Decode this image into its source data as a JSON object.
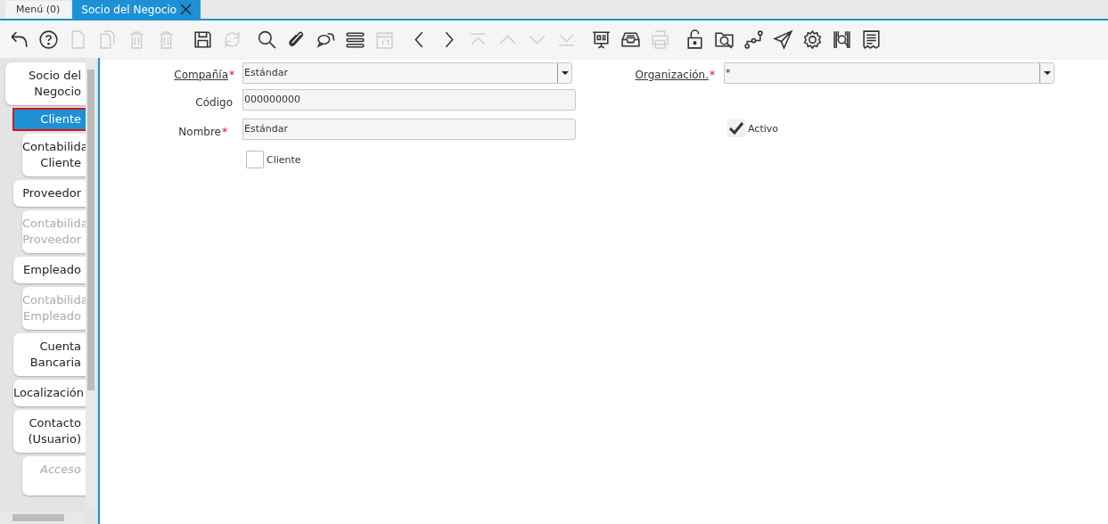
{
  "window_tabs": [
    {
      "label": "Menú (0)",
      "selected": false,
      "closable": false
    },
    {
      "label": "Socio del Negocio",
      "selected": true,
      "closable": true
    }
  ],
  "toolbar": [
    {
      "kind": "undo",
      "disabled": false
    },
    {
      "kind": "help",
      "disabled": false
    },
    {
      "kind": "new",
      "disabled": true
    },
    {
      "kind": "copy",
      "disabled": true
    },
    {
      "kind": "delete",
      "disabled": true
    },
    {
      "kind": "delete",
      "disabled": true
    },
    {
      "kind": "save",
      "disabled": false
    },
    {
      "kind": "refresh",
      "disabled": true
    },
    {
      "kind": "search",
      "disabled": false
    },
    {
      "kind": "attach",
      "disabled": false
    },
    {
      "kind": "chat",
      "disabled": false
    },
    {
      "kind": "menu",
      "disabled": false
    },
    {
      "kind": "calendar",
      "disabled": true
    },
    {
      "kind": "prev",
      "disabled": false
    },
    {
      "kind": "next",
      "disabled": false
    },
    {
      "kind": "first",
      "disabled": true
    },
    {
      "kind": "up",
      "disabled": true
    },
    {
      "kind": "down",
      "disabled": true
    },
    {
      "kind": "last",
      "disabled": true
    },
    {
      "kind": "presentation",
      "disabled": false
    },
    {
      "kind": "archive",
      "disabled": false
    },
    {
      "kind": "print",
      "disabled": true
    },
    {
      "kind": "lock",
      "disabled": false
    },
    {
      "kind": "folder-search",
      "disabled": false
    },
    {
      "kind": "workflow",
      "disabled": false
    },
    {
      "kind": "send",
      "disabled": false
    },
    {
      "kind": "settings",
      "disabled": false
    },
    {
      "kind": "barcode",
      "disabled": false
    },
    {
      "kind": "document",
      "disabled": false
    }
  ],
  "sidebar": {
    "items": [
      {
        "lines": [
          "Socio del",
          "Negocio"
        ],
        "selected": false,
        "disabled": false,
        "children": [
          {
            "lines": [
              "Cliente"
            ],
            "selected": true,
            "disabled": false,
            "children": [
              {
                "lines": [
                  "Contabilida",
                  "Cliente"
                ],
                "selected": false,
                "disabled": false
              }
            ]
          },
          {
            "lines": [
              "Proveedor"
            ],
            "selected": false,
            "disabled": false,
            "children": [
              {
                "lines": [
                  "Contabilida",
                  "Proveedor"
                ],
                "selected": false,
                "disabled": true
              }
            ]
          },
          {
            "lines": [
              "Empleado"
            ],
            "selected": false,
            "disabled": false,
            "children": [
              {
                "lines": [
                  "Contabilida",
                  "Empleado"
                ],
                "selected": false,
                "disabled": true
              }
            ]
          },
          {
            "lines": [
              "Cuenta",
              "Bancaria"
            ],
            "selected": false,
            "disabled": false
          },
          {
            "lines": [
              "Localización"
            ],
            "selected": false,
            "disabled": false
          },
          {
            "lines": [
              "Contacto",
              "(Usuario)"
            ],
            "selected": false,
            "disabled": false,
            "children": [
              {
                "lines": [
                  "Acceso"
                ],
                "selected": false,
                "disabled": true
              }
            ]
          }
        ]
      }
    ]
  },
  "form": {
    "company": {
      "label": "Compañía",
      "required": true,
      "value": "Estándar"
    },
    "organization": {
      "label": "Organización.",
      "required": true,
      "value": "*"
    },
    "code": {
      "label": "Código",
      "required": false,
      "value": "000000000"
    },
    "name": {
      "label": "Nombre",
      "required": true,
      "value": "Estándar"
    },
    "active": {
      "label": "Activo",
      "checked": true
    },
    "customer": {
      "label": "Cliente",
      "checked": false
    }
  }
}
